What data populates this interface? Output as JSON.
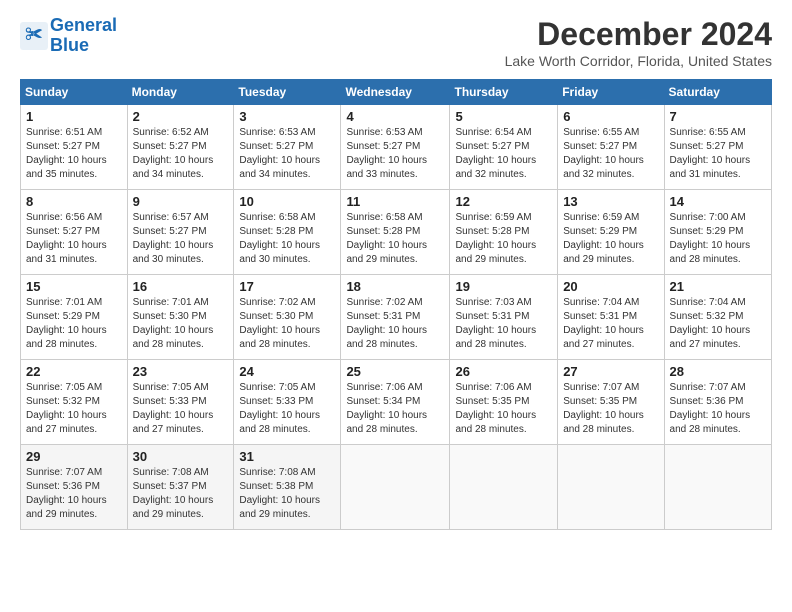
{
  "logo": {
    "line1": "General",
    "line2": "Blue"
  },
  "title": "December 2024",
  "location": "Lake Worth Corridor, Florida, United States",
  "days_header": [
    "Sunday",
    "Monday",
    "Tuesday",
    "Wednesday",
    "Thursday",
    "Friday",
    "Saturday"
  ],
  "weeks": [
    [
      {
        "day": "1",
        "sunrise": "6:51 AM",
        "sunset": "5:27 PM",
        "daylight": "10 hours and 35 minutes."
      },
      {
        "day": "2",
        "sunrise": "6:52 AM",
        "sunset": "5:27 PM",
        "daylight": "10 hours and 34 minutes."
      },
      {
        "day": "3",
        "sunrise": "6:53 AM",
        "sunset": "5:27 PM",
        "daylight": "10 hours and 34 minutes."
      },
      {
        "day": "4",
        "sunrise": "6:53 AM",
        "sunset": "5:27 PM",
        "daylight": "10 hours and 33 minutes."
      },
      {
        "day": "5",
        "sunrise": "6:54 AM",
        "sunset": "5:27 PM",
        "daylight": "10 hours and 32 minutes."
      },
      {
        "day": "6",
        "sunrise": "6:55 AM",
        "sunset": "5:27 PM",
        "daylight": "10 hours and 32 minutes."
      },
      {
        "day": "7",
        "sunrise": "6:55 AM",
        "sunset": "5:27 PM",
        "daylight": "10 hours and 31 minutes."
      }
    ],
    [
      {
        "day": "8",
        "sunrise": "6:56 AM",
        "sunset": "5:27 PM",
        "daylight": "10 hours and 31 minutes."
      },
      {
        "day": "9",
        "sunrise": "6:57 AM",
        "sunset": "5:27 PM",
        "daylight": "10 hours and 30 minutes."
      },
      {
        "day": "10",
        "sunrise": "6:58 AM",
        "sunset": "5:28 PM",
        "daylight": "10 hours and 30 minutes."
      },
      {
        "day": "11",
        "sunrise": "6:58 AM",
        "sunset": "5:28 PM",
        "daylight": "10 hours and 29 minutes."
      },
      {
        "day": "12",
        "sunrise": "6:59 AM",
        "sunset": "5:28 PM",
        "daylight": "10 hours and 29 minutes."
      },
      {
        "day": "13",
        "sunrise": "6:59 AM",
        "sunset": "5:29 PM",
        "daylight": "10 hours and 29 minutes."
      },
      {
        "day": "14",
        "sunrise": "7:00 AM",
        "sunset": "5:29 PM",
        "daylight": "10 hours and 28 minutes."
      }
    ],
    [
      {
        "day": "15",
        "sunrise": "7:01 AM",
        "sunset": "5:29 PM",
        "daylight": "10 hours and 28 minutes."
      },
      {
        "day": "16",
        "sunrise": "7:01 AM",
        "sunset": "5:30 PM",
        "daylight": "10 hours and 28 minutes."
      },
      {
        "day": "17",
        "sunrise": "7:02 AM",
        "sunset": "5:30 PM",
        "daylight": "10 hours and 28 minutes."
      },
      {
        "day": "18",
        "sunrise": "7:02 AM",
        "sunset": "5:31 PM",
        "daylight": "10 hours and 28 minutes."
      },
      {
        "day": "19",
        "sunrise": "7:03 AM",
        "sunset": "5:31 PM",
        "daylight": "10 hours and 28 minutes."
      },
      {
        "day": "20",
        "sunrise": "7:04 AM",
        "sunset": "5:31 PM",
        "daylight": "10 hours and 27 minutes."
      },
      {
        "day": "21",
        "sunrise": "7:04 AM",
        "sunset": "5:32 PM",
        "daylight": "10 hours and 27 minutes."
      }
    ],
    [
      {
        "day": "22",
        "sunrise": "7:05 AM",
        "sunset": "5:32 PM",
        "daylight": "10 hours and 27 minutes."
      },
      {
        "day": "23",
        "sunrise": "7:05 AM",
        "sunset": "5:33 PM",
        "daylight": "10 hours and 27 minutes."
      },
      {
        "day": "24",
        "sunrise": "7:05 AM",
        "sunset": "5:33 PM",
        "daylight": "10 hours and 28 minutes."
      },
      {
        "day": "25",
        "sunrise": "7:06 AM",
        "sunset": "5:34 PM",
        "daylight": "10 hours and 28 minutes."
      },
      {
        "day": "26",
        "sunrise": "7:06 AM",
        "sunset": "5:35 PM",
        "daylight": "10 hours and 28 minutes."
      },
      {
        "day": "27",
        "sunrise": "7:07 AM",
        "sunset": "5:35 PM",
        "daylight": "10 hours and 28 minutes."
      },
      {
        "day": "28",
        "sunrise": "7:07 AM",
        "sunset": "5:36 PM",
        "daylight": "10 hours and 28 minutes."
      }
    ],
    [
      {
        "day": "29",
        "sunrise": "7:07 AM",
        "sunset": "5:36 PM",
        "daylight": "10 hours and 29 minutes."
      },
      {
        "day": "30",
        "sunrise": "7:08 AM",
        "sunset": "5:37 PM",
        "daylight": "10 hours and 29 minutes."
      },
      {
        "day": "31",
        "sunrise": "7:08 AM",
        "sunset": "5:38 PM",
        "daylight": "10 hours and 29 minutes."
      },
      null,
      null,
      null,
      null
    ]
  ]
}
